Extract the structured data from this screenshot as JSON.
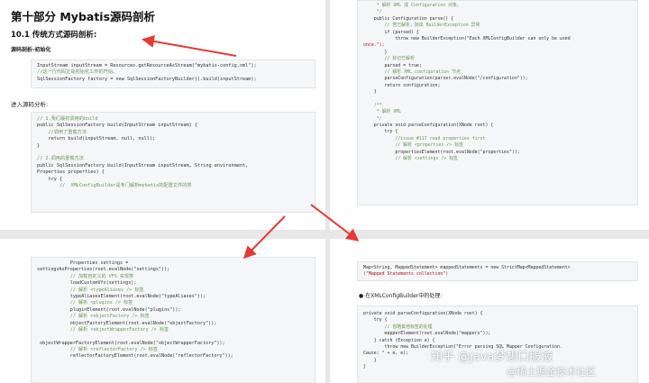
{
  "page_top_left": {
    "title": "第十部分 Mybatis源码剖析",
    "section": "10.1 传统方式源码剖析:",
    "subsection": "源码剖析-初始化",
    "code1": [
      "InputStream inputStream = Resources.getResourceAsStream(\"mybatis-config.xml\");",
      "//这一行代码正是初始化工作的开始。",
      "SqlSessionFactory factory = new SqlSessionFactoryBuilder().build(inputStream);"
    ],
    "para": "进入源码分析:",
    "code2": [
      "// 1.我们最初调用的build",
      "public SqlSessionFactory build(InputStream inputStream) {",
      "    //调用了重载方法",
      "    return build(inputStream, null, null);",
      "}",
      "",
      "// 2.调用的重载方法",
      "public SqlSessionFactory build(InputStream inputStream, String environment,",
      "Properties properties) {",
      "    try {",
      "        //  XMLConfigBuilder是专门解析mybatis的配置文件的类"
    ]
  },
  "page_top_right": {
    "code": [
      "     * 解析 XML 成 Configuration 对象。",
      "     */",
      "    public Configuration parse() {",
      "        // 若已解析，抛出 BuilderException 异常",
      "        if (parsed) {",
      "            throw new BuilderException(\"Each XMLConfigBuilder can only be used",
      "once.\");",
      "        }",
      "        // 标记已解析",
      "        parsed = true;",
      "        // 解析 XML configuration 节点",
      "        parseConfiguration(parser.evalNode(\"/configuration\"));",
      "        return configuration;",
      "    }",
      "",
      "    /**",
      "     * 解析 XML",
      "     */",
      "    private void parseConfiguration(XNode root) {",
      "        try {",
      "            //issue #117 read properties first",
      "            // 解析 <properties /> 标签",
      "            propertiesElement(root.evalNode(\"properties\"));",
      "            // 解析 <settings /> 标签"
    ]
  },
  "page_bottom_left": {
    "code": [
      "            Properties settings =",
      "settingsAsProperties(root.evalNode(\"settings\"));",
      "            // 加载自定义的 VFS 实现类",
      "            loadCustomVfs(settings);",
      "            // 解析 <typeAliases /> 标签",
      "            typeAliasesElement(root.evalNode(\"typeAliases\"));",
      "            // 解析 <plugins /> 标签",
      "            pluginElement(root.evalNode(\"plugins\"));",
      "            // 解析 <objectFactory /> 标签",
      "            objectFactoryElement(root.evalNode(\"objectFactory\"));",
      "            // 解析 <objectWrapperFactory /> 标签",
      "",
      " objectWrapperFactoryElement(root.evalNode(\"objectWrapperFactory\"));",
      "            // 解析 <reflectorFactory /> 标签",
      "            reflectorFactoryElement(root.evalNode(\"reflectorFactory\"));"
    ]
  },
  "page_bottom_right": {
    "code1": [
      "Map<String, MappedStatement> mappedStatements = new StrictMap<MappedStatement>",
      "(\"Mapped Statements collection\")"
    ],
    "bullet": "在XMLConfigBuilder中的处理:",
    "code2": [
      "private void parseConfiguration(XNode root) {",
      "    try {",
      "        // 省略其他标签的处理",
      "        mapperElement(root.evalNode(\"mappers\"));",
      "    } catch (Exception e) {",
      "        throw new BuilderException(\"Error parsing SQL Mapper Configuration.",
      "Cause: \" + e, e);",
      "    }",
      "}"
    ]
  },
  "watermark": {
    "line1": "知乎 @java梦想口服液",
    "line2": "@稀土掘金技术社区"
  },
  "colors": {
    "arrow": "#e53935",
    "comment": "#6a9955",
    "keyword": "#7a3e9d",
    "string": "#a31515",
    "type": "#1f6feb"
  }
}
